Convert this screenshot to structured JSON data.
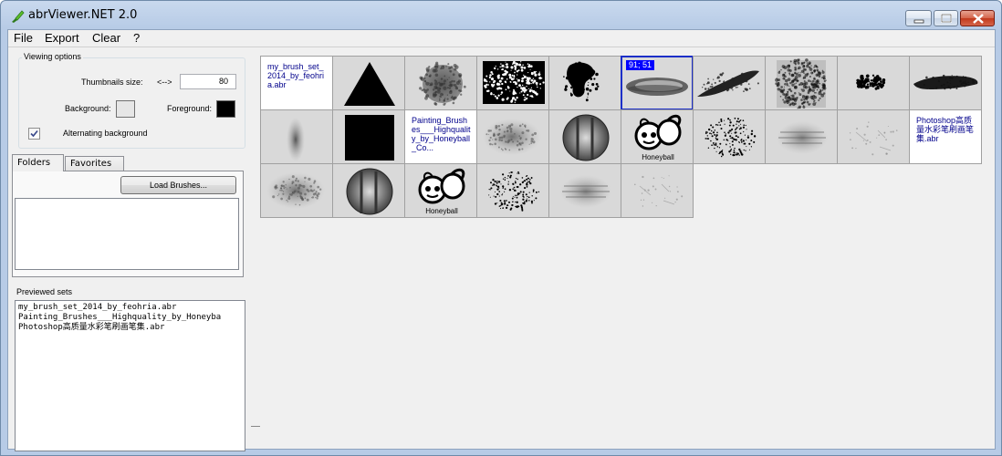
{
  "window": {
    "title": "abrViewer.NET 2.0",
    "accent": "#b7cbe6"
  },
  "menu": [
    "File",
    "Export",
    "Clear",
    "?"
  ],
  "viewing_options": {
    "title": "Viewing options",
    "thumbnails_label": "Thumbnails size:",
    "arrows": "<-->",
    "thumbnails_size": "80",
    "background_label": "Background:",
    "background_color": "#e6e6e6",
    "foreground_label": "Foreground:",
    "foreground_color": "#000000",
    "alternating_label": "Alternating background",
    "alternating_checked": true
  },
  "tabs": [
    "Folders",
    "Favorites"
  ],
  "load_brushes_label": "Load Brushes...",
  "previewed_sets_label": "Previewed sets",
  "previewed_sets": [
    "my_brush_set_2014_by_feohria.abr",
    "Painting_Brushes___Highquality_by_Honeyba",
    "Photoshop高质量水彩笔刷画笔集.abr"
  ],
  "thumbnails": [
    {
      "kind": "filename",
      "label": "my_brush_set_2014_by_feohria.abr"
    },
    {
      "kind": "triangle"
    },
    {
      "kind": "splat"
    },
    {
      "kind": "noise-rect"
    },
    {
      "kind": "ink-blob"
    },
    {
      "kind": "dry-stroke",
      "selected": true,
      "coord": "91; 51"
    },
    {
      "kind": "smudge-stroke"
    },
    {
      "kind": "texture"
    },
    {
      "kind": "dots-cluster"
    },
    {
      "kind": "long-stroke"
    },
    {
      "kind": "soft-spot"
    },
    {
      "kind": "black-square"
    },
    {
      "kind": "filename",
      "label": "Painting_Brushes___Highquality_by_Honeyball_Co..."
    },
    {
      "kind": "cloud"
    },
    {
      "kind": "circle-strokes"
    },
    {
      "kind": "bee",
      "caption": "Honeyball"
    },
    {
      "kind": "scatter"
    },
    {
      "kind": "blur-lines"
    },
    {
      "kind": "faint-dots"
    },
    {
      "kind": "filename",
      "label": "Photoshop高质量水彩笔刷画笔集.abr"
    },
    {
      "kind": "cloud"
    },
    {
      "kind": "circle-strokes"
    },
    {
      "kind": "bee",
      "caption": "Honeyball"
    },
    {
      "kind": "scatter"
    },
    {
      "kind": "blur-lines"
    },
    {
      "kind": "faint-dots"
    }
  ]
}
